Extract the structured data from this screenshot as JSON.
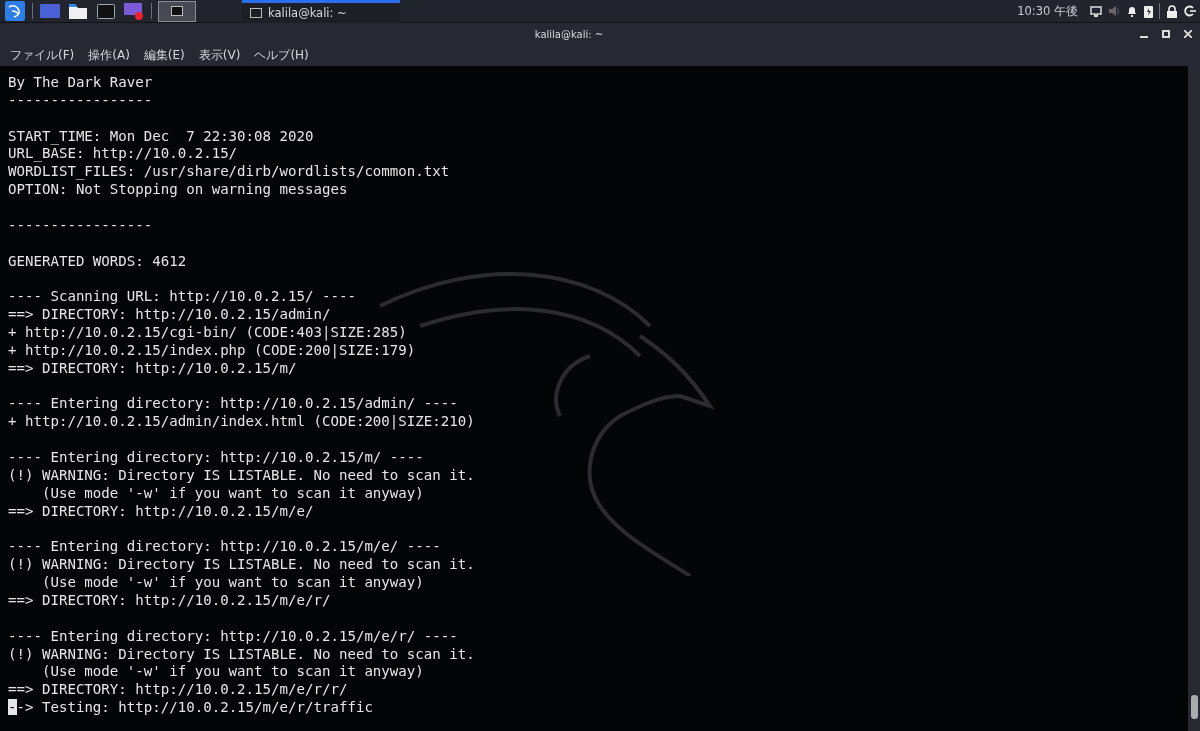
{
  "panel": {
    "launchers": [
      {
        "kind": "desktop"
      },
      {
        "kind": "files"
      },
      {
        "kind": "terminal"
      },
      {
        "kind": "recorder"
      }
    ],
    "workspace": {
      "selected": true
    },
    "tasks": [
      {
        "label": "kalila@kali: ~",
        "selected": true
      }
    ],
    "clock": "10:30 午後"
  },
  "window": {
    "title": "kalila@kali: ~"
  },
  "menu": [
    "ファイル(F)",
    "操作(A)",
    "編集(E)",
    "表示(V)",
    "ヘルプ(H)"
  ],
  "terminal": {
    "blocks": [
      [
        "By The Dark Raver",
        "-----------------"
      ],
      [
        "START_TIME: Mon Dec  7 22:30:08 2020",
        "URL_BASE: http://10.0.2.15/",
        "WORDLIST_FILES: /usr/share/dirb/wordlists/common.txt",
        "OPTION: Not Stopping on warning messages"
      ],
      [
        "-----------------"
      ],
      [
        "GENERATED WORDS: 4612"
      ],
      [
        "---- Scanning URL: http://10.0.2.15/ ----",
        "==> DIRECTORY: http://10.0.2.15/admin/",
        "+ http://10.0.2.15/cgi-bin/ (CODE:403|SIZE:285)",
        "+ http://10.0.2.15/index.php (CODE:200|SIZE:179)",
        "==> DIRECTORY: http://10.0.2.15/m/"
      ],
      [
        "---- Entering directory: http://10.0.2.15/admin/ ----",
        "+ http://10.0.2.15/admin/index.html (CODE:200|SIZE:210)"
      ],
      [
        "---- Entering directory: http://10.0.2.15/m/ ----",
        "(!) WARNING: Directory IS LISTABLE. No need to scan it.",
        "    (Use mode '-w' if you want to scan it anyway)",
        "==> DIRECTORY: http://10.0.2.15/m/e/"
      ],
      [
        "---- Entering directory: http://10.0.2.15/m/e/ ----",
        "(!) WARNING: Directory IS LISTABLE. No need to scan it.",
        "    (Use mode '-w' if you want to scan it anyway)",
        "==> DIRECTORY: http://10.0.2.15/m/e/r/"
      ],
      [
        "---- Entering directory: http://10.0.2.15/m/e/r/ ----",
        "(!) WARNING: Directory IS LISTABLE. No need to scan it.",
        "    (Use mode '-w' if you want to scan it anyway)",
        "==> DIRECTORY: http://10.0.2.15/m/e/r/r/"
      ]
    ],
    "current_line": {
      "cursor": "-",
      "text": "-> Testing: http://10.0.2.15/m/e/r/traffic"
    }
  }
}
